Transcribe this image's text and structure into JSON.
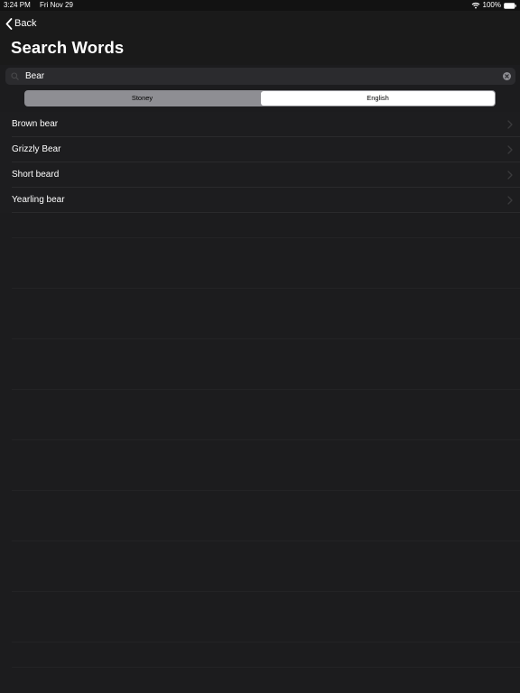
{
  "status_bar": {
    "time": "3:24 PM",
    "date": "Fri Nov 29",
    "battery": "100%"
  },
  "nav": {
    "back_label": "Back",
    "title": "Search Words"
  },
  "search": {
    "value": "Bear",
    "placeholder": ""
  },
  "segments": {
    "options": [
      "Stoney",
      "English"
    ],
    "selected": "English"
  },
  "results": [
    {
      "label": "Brown bear"
    },
    {
      "label": "Grizzly Bear"
    },
    {
      "label": "Short beard"
    },
    {
      "label": "Yearling bear"
    }
  ],
  "icons": {
    "back": "chevron-left-icon",
    "search": "search-icon",
    "clear": "clear-circle-icon",
    "row": "chevron-right-icon",
    "wifi": "wifi-icon",
    "battery": "battery-icon"
  },
  "colors": {
    "background": "#1c1c1e",
    "segment_track": "#8e8e93",
    "segment_selected": "#ffffff",
    "text": "#ffffff"
  }
}
